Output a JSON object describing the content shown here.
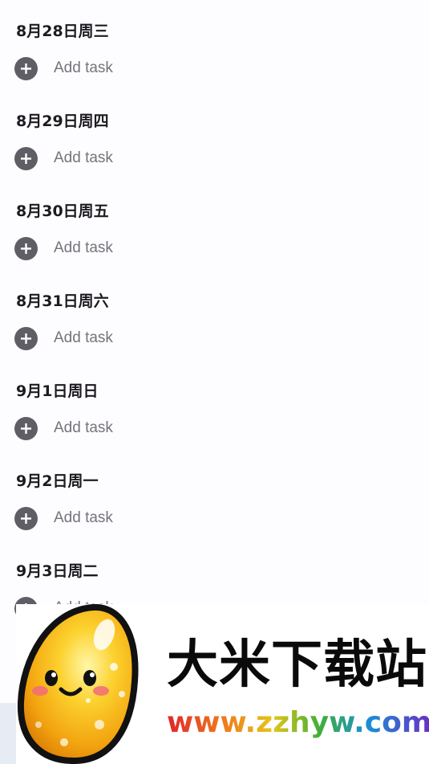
{
  "days": [
    {
      "heading": "8月28日周三",
      "add_label": "Add task"
    },
    {
      "heading": "8月29日周四",
      "add_label": "Add task"
    },
    {
      "heading": "8月30日周五",
      "add_label": "Add task"
    },
    {
      "heading": "8月31日周六",
      "add_label": "Add task"
    },
    {
      "heading": "9月1日周日",
      "add_label": "Add task"
    },
    {
      "heading": "9月2日周一",
      "add_label": "Add task"
    },
    {
      "heading": "9月3日周二",
      "add_label": "Add task"
    }
  ],
  "watermark": {
    "brand_name": "大米下载站",
    "url": "www.zzhyw.com"
  },
  "colors": {
    "background": "#fdfcff",
    "heading_text": "#1d1b20",
    "add_icon": "#5f5e64",
    "add_label": "#75747a"
  },
  "icons": {
    "add_task": "plus-circle-icon",
    "mascot": "rice-grain-mascot-icon"
  }
}
